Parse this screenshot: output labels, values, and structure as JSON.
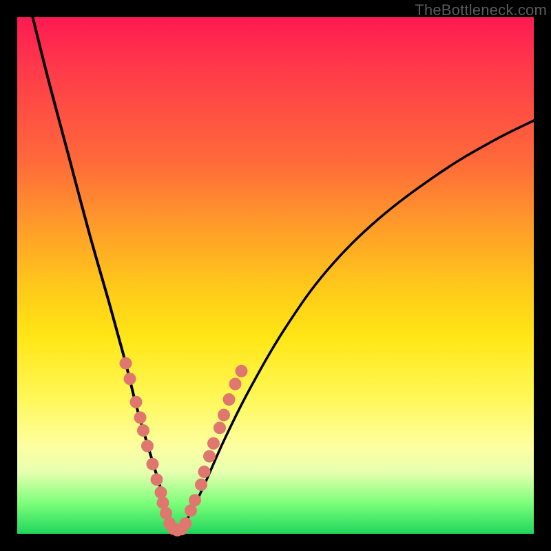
{
  "watermark": "TheBottleneck.com",
  "chart_data": {
    "type": "line",
    "title": "",
    "xlabel": "",
    "ylabel": "",
    "xlim": [
      0,
      100
    ],
    "ylim": [
      0,
      100
    ],
    "grid": false,
    "legend": false,
    "series": [
      {
        "name": "left-curve",
        "x": [
          3,
          6,
          10,
          14,
          18,
          21,
          23,
          25,
          26.5,
          28,
          29,
          30,
          31
        ],
        "values": [
          100,
          88,
          73,
          58,
          44,
          33,
          25,
          18,
          13,
          8,
          4.5,
          2,
          0.5
        ]
      },
      {
        "name": "right-curve",
        "x": [
          31,
          33,
          36,
          40,
          45,
          52,
          60,
          70,
          82,
          92,
          100
        ],
        "values": [
          0.5,
          3,
          9,
          18,
          28,
          40,
          51,
          61,
          70,
          76,
          80
        ]
      }
    ],
    "markers": {
      "name": "pink-dots",
      "color": "#e0776f",
      "points": [
        {
          "x": 21.0,
          "y": 33.0
        },
        {
          "x": 21.8,
          "y": 30.0
        },
        {
          "x": 23.0,
          "y": 25.5
        },
        {
          "x": 23.8,
          "y": 22.5
        },
        {
          "x": 24.4,
          "y": 20.0
        },
        {
          "x": 25.2,
          "y": 17.0
        },
        {
          "x": 26.2,
          "y": 13.5
        },
        {
          "x": 27.0,
          "y": 10.5
        },
        {
          "x": 27.8,
          "y": 8.0
        },
        {
          "x": 28.2,
          "y": 6.0
        },
        {
          "x": 28.8,
          "y": 4.0
        },
        {
          "x": 29.5,
          "y": 2.0
        },
        {
          "x": 30.2,
          "y": 1.0
        },
        {
          "x": 31.0,
          "y": 0.7
        },
        {
          "x": 31.8,
          "y": 0.9
        },
        {
          "x": 32.6,
          "y": 2.0
        },
        {
          "x": 33.6,
          "y": 4.5
        },
        {
          "x": 34.4,
          "y": 6.5
        },
        {
          "x": 35.6,
          "y": 9.5
        },
        {
          "x": 36.2,
          "y": 12.0
        },
        {
          "x": 37.2,
          "y": 15.0
        },
        {
          "x": 38.0,
          "y": 17.5
        },
        {
          "x": 39.2,
          "y": 20.5
        },
        {
          "x": 40.0,
          "y": 23.0
        },
        {
          "x": 41.0,
          "y": 26.0
        },
        {
          "x": 42.2,
          "y": 29.0
        },
        {
          "x": 43.4,
          "y": 31.5
        }
      ]
    }
  }
}
